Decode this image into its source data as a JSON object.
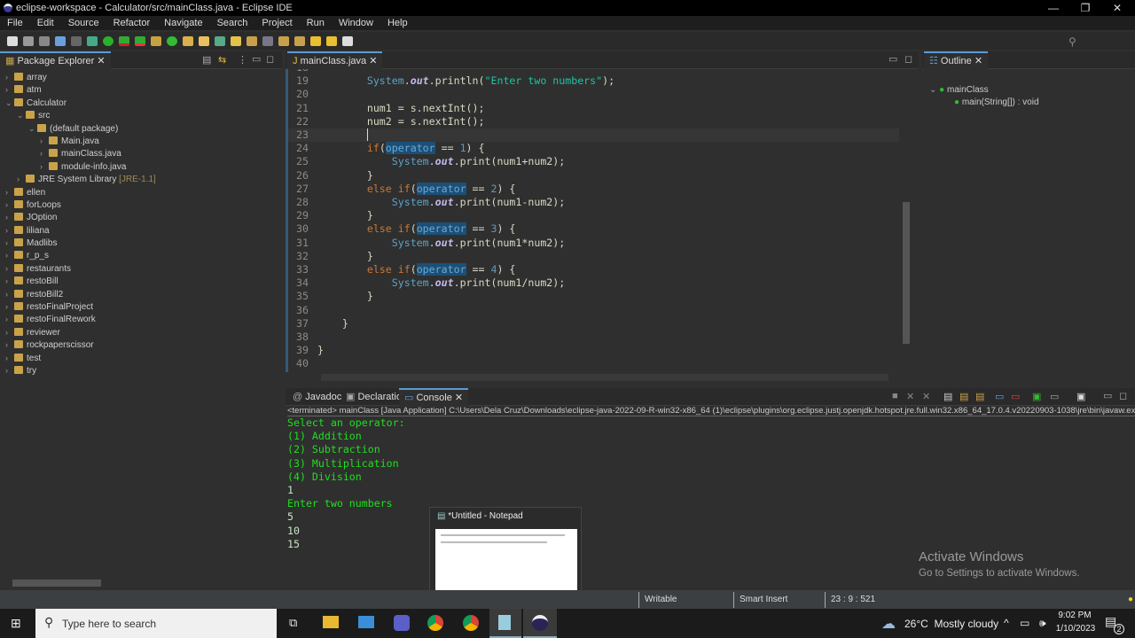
{
  "window": {
    "title": "eclipse-workspace - Calculator/src/mainClass.java - Eclipse IDE",
    "minimize": "—",
    "maximize": "❐",
    "close": "✕"
  },
  "menu": [
    "File",
    "Edit",
    "Source",
    "Refactor",
    "Navigate",
    "Search",
    "Project",
    "Run",
    "Window",
    "Help"
  ],
  "package_explorer": {
    "title": "Package Explorer",
    "items": [
      {
        "label": "array",
        "level": 0,
        "arrow": "›"
      },
      {
        "label": "atm",
        "level": 0,
        "arrow": "›"
      },
      {
        "label": "Calculator",
        "level": 0,
        "arrow": "⌄"
      },
      {
        "label": "src",
        "level": 1,
        "arrow": "⌄"
      },
      {
        "label": "(default package)",
        "level": 2,
        "arrow": "⌄"
      },
      {
        "label": "Main.java",
        "level": 3,
        "arrow": "›"
      },
      {
        "label": "mainClass.java",
        "level": 3,
        "arrow": "›"
      },
      {
        "label": "module-info.java",
        "level": 3,
        "arrow": "›"
      },
      {
        "label": "JRE System Library",
        "level": 1,
        "arrow": "›",
        "deco": "[JRE-1.1]"
      },
      {
        "label": "ellen",
        "level": 0,
        "arrow": "›"
      },
      {
        "label": "forLoops",
        "level": 0,
        "arrow": "›"
      },
      {
        "label": "JOption",
        "level": 0,
        "arrow": "›"
      },
      {
        "label": "liliana",
        "level": 0,
        "arrow": "›"
      },
      {
        "label": "Madlibs",
        "level": 0,
        "arrow": "›"
      },
      {
        "label": "r_p_s",
        "level": 0,
        "arrow": "›"
      },
      {
        "label": "restaurants",
        "level": 0,
        "arrow": "›"
      },
      {
        "label": "restoBill",
        "level": 0,
        "arrow": "›"
      },
      {
        "label": "restoBill2",
        "level": 0,
        "arrow": "›"
      },
      {
        "label": "restoFinalProject",
        "level": 0,
        "arrow": "›"
      },
      {
        "label": "restoFinalRework",
        "level": 0,
        "arrow": "›"
      },
      {
        "label": "reviewer",
        "level": 0,
        "arrow": "›"
      },
      {
        "label": "rockpaperscissor",
        "level": 0,
        "arrow": "›"
      },
      {
        "label": "test",
        "level": 0,
        "arrow": "›"
      },
      {
        "label": "try",
        "level": 0,
        "arrow": "›"
      }
    ]
  },
  "editor": {
    "tab": "mainClass.java",
    "current_line": 23,
    "lines": [
      {
        "n": "18",
        "t": []
      },
      {
        "n": "19",
        "t": [
          [
            "p",
            "        "
          ],
          [
            "s",
            "System"
          ],
          [
            "p",
            "."
          ],
          [
            "o",
            "out"
          ],
          [
            "p",
            ".println("
          ],
          [
            "str",
            "\"Enter two numbers\""
          ],
          [
            "p",
            ");"
          ]
        ]
      },
      {
        "n": "20",
        "t": []
      },
      {
        "n": "21",
        "t": [
          [
            "p",
            "        num1 = s.nextInt();"
          ]
        ]
      },
      {
        "n": "22",
        "t": [
          [
            "p",
            "        num2 = s.nextInt();"
          ]
        ]
      },
      {
        "n": "23",
        "t": [
          [
            "p",
            "        "
          ]
        ]
      },
      {
        "n": "24",
        "t": [
          [
            "p",
            "        "
          ],
          [
            "k",
            "if"
          ],
          [
            "p",
            "("
          ],
          [
            "v",
            "operator"
          ],
          [
            "p",
            " == "
          ],
          [
            "n",
            "1"
          ],
          [
            "p",
            ") {"
          ]
        ]
      },
      {
        "n": "25",
        "t": [
          [
            "p",
            "            "
          ],
          [
            "s",
            "System"
          ],
          [
            "p",
            "."
          ],
          [
            "o",
            "out"
          ],
          [
            "p",
            ".print(num1+num2);"
          ]
        ]
      },
      {
        "n": "26",
        "t": [
          [
            "p",
            "        }"
          ]
        ]
      },
      {
        "n": "27",
        "t": [
          [
            "p",
            "        "
          ],
          [
            "k",
            "else if"
          ],
          [
            "p",
            "("
          ],
          [
            "v",
            "operator"
          ],
          [
            "p",
            " == "
          ],
          [
            "n",
            "2"
          ],
          [
            "p",
            ") {"
          ]
        ]
      },
      {
        "n": "28",
        "t": [
          [
            "p",
            "            "
          ],
          [
            "s",
            "System"
          ],
          [
            "p",
            "."
          ],
          [
            "o",
            "out"
          ],
          [
            "p",
            ".print(num1-num2);"
          ]
        ]
      },
      {
        "n": "29",
        "t": [
          [
            "p",
            "        }"
          ]
        ]
      },
      {
        "n": "30",
        "t": [
          [
            "p",
            "        "
          ],
          [
            "k",
            "else if"
          ],
          [
            "p",
            "("
          ],
          [
            "v",
            "operator"
          ],
          [
            "p",
            " == "
          ],
          [
            "n",
            "3"
          ],
          [
            "p",
            ") {"
          ]
        ]
      },
      {
        "n": "31",
        "t": [
          [
            "p",
            "            "
          ],
          [
            "s",
            "System"
          ],
          [
            "p",
            "."
          ],
          [
            "o",
            "out"
          ],
          [
            "p",
            ".print(num1*num2);"
          ]
        ]
      },
      {
        "n": "32",
        "t": [
          [
            "p",
            "        }"
          ]
        ]
      },
      {
        "n": "33",
        "t": [
          [
            "p",
            "        "
          ],
          [
            "k",
            "else if"
          ],
          [
            "p",
            "("
          ],
          [
            "v",
            "operator"
          ],
          [
            "p",
            " == "
          ],
          [
            "n",
            "4"
          ],
          [
            "p",
            ") {"
          ]
        ]
      },
      {
        "n": "34",
        "t": [
          [
            "p",
            "            "
          ],
          [
            "s",
            "System"
          ],
          [
            "p",
            "."
          ],
          [
            "o",
            "out"
          ],
          [
            "p",
            ".print(num1/num2);"
          ]
        ]
      },
      {
        "n": "35",
        "t": [
          [
            "p",
            "        }"
          ]
        ]
      },
      {
        "n": "36",
        "t": []
      },
      {
        "n": "37",
        "t": [
          [
            "p",
            "    }"
          ]
        ]
      },
      {
        "n": "38",
        "t": []
      },
      {
        "n": "39",
        "t": [
          [
            "p",
            "}"
          ]
        ]
      },
      {
        "n": "40",
        "t": []
      }
    ]
  },
  "outline": {
    "title": "Outline",
    "class": "mainClass",
    "method": "main(String[]) : void"
  },
  "console": {
    "tabs": [
      "Javadoc",
      "Declaration",
      "Console"
    ],
    "header": "<terminated> mainClass [Java Application] C:\\Users\\Dela Cruz\\Downloads\\eclipse-java-2022-09-R-win32-x86_64 (1)\\eclipse\\plugins\\org.eclipse.justj.openjdk.hotspot.jre.full.win32.x86_64_17.0.4.v20220903-1038\\jre\\bin\\javaw.exe",
    "output": [
      "Select an operator:",
      "(1) Addition",
      "(2) Subtraction",
      "(3) Multiplication",
      "(4) Division",
      "1",
      "Enter two numbers",
      "5",
      "10",
      "15"
    ]
  },
  "watermark": {
    "title": "Activate Windows",
    "subtitle": "Go to Settings to activate Windows."
  },
  "notepad_preview": {
    "title": "*Untitled - Notepad"
  },
  "status": {
    "writable": "Writable",
    "insert": "Smart Insert",
    "position": "23 : 9 : 521"
  },
  "taskbar": {
    "search_placeholder": "Type here to search",
    "weather": "26°C  Mostly cloudy",
    "time": "9:02 PM",
    "date": "1/10/2023",
    "notifications": "2"
  }
}
